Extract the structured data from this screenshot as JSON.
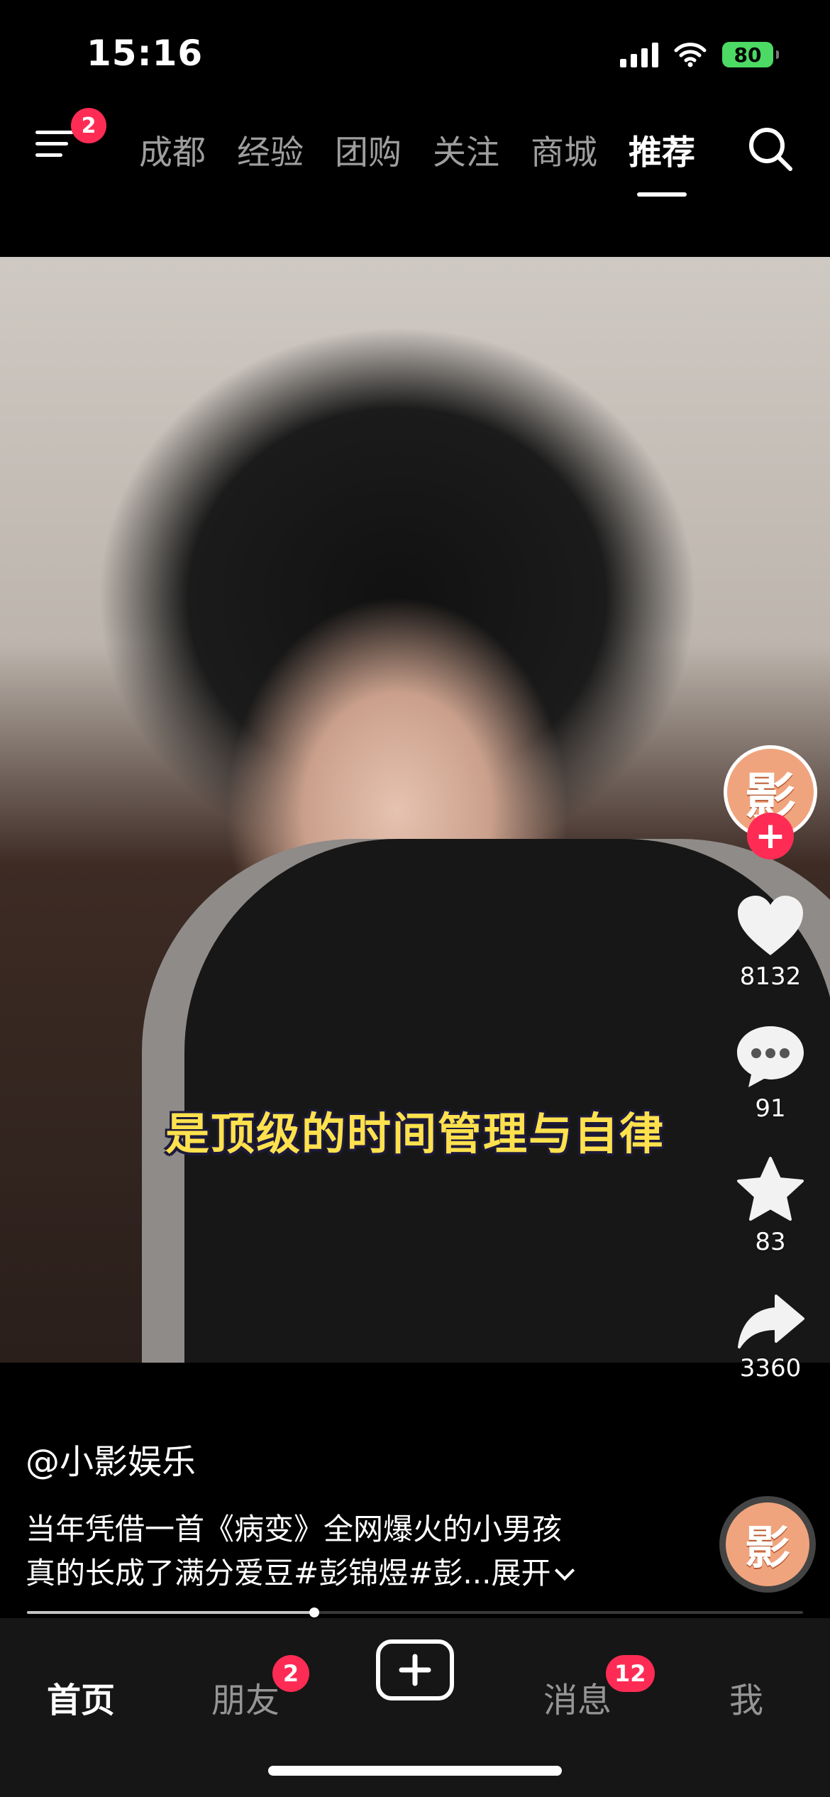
{
  "status_bar": {
    "time": "15:16",
    "battery": "80"
  },
  "top_nav": {
    "menu_badge": "2",
    "tabs": [
      {
        "label": "成都",
        "active": false
      },
      {
        "label": "经验",
        "active": false
      },
      {
        "label": "团购",
        "active": false
      },
      {
        "label": "关注",
        "active": false
      },
      {
        "label": "商城",
        "active": false
      },
      {
        "label": "推荐",
        "active": true
      }
    ]
  },
  "video": {
    "subtitle": "是顶级的时间管理与自律"
  },
  "actions": {
    "avatar_glyph": "影",
    "likes": "8132",
    "comments": "91",
    "favorites": "83",
    "shares": "3360"
  },
  "post": {
    "author": "@小影娱乐",
    "caption_line1": "当年凭借一首《病变》全网爆火的小男孩",
    "caption_line2": "真的长成了满分爱豆#彭锦煜#彭...",
    "expand_label": "展开"
  },
  "progress": {
    "played_fraction": 0.37
  },
  "bottom_nav": {
    "home": "首页",
    "friends": "朋友",
    "friends_badge": "2",
    "messages": "消息",
    "messages_badge": "12",
    "me": "我"
  },
  "colors": {
    "accent": "#fe2c55",
    "subtitle": "#ffe14d",
    "avatar_bg": "#f0a47d"
  }
}
